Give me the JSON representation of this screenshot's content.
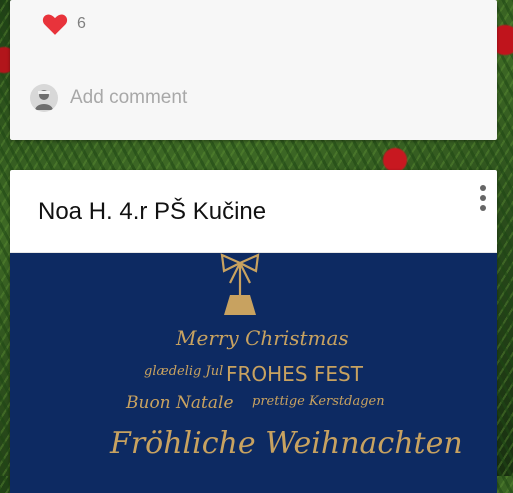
{
  "top_card": {
    "likes_count": "6",
    "add_comment_label": "Add comment"
  },
  "post": {
    "author_title": "Noa H. 4.r PŠ Kučine",
    "menu_icon": "more-vertical-icon",
    "image": {
      "line1": "Merry Christmas",
      "line2a": "glædelig Jul",
      "line2b": "FROHES FEST",
      "line3a": "Buon Natale",
      "line3b": "prettige Kerstdagen",
      "line4": "Fröhliche Weihnachten"
    }
  },
  "colors": {
    "heart": "#e8333b",
    "image_background": "#0d2a62",
    "gold": "#c8a260"
  }
}
